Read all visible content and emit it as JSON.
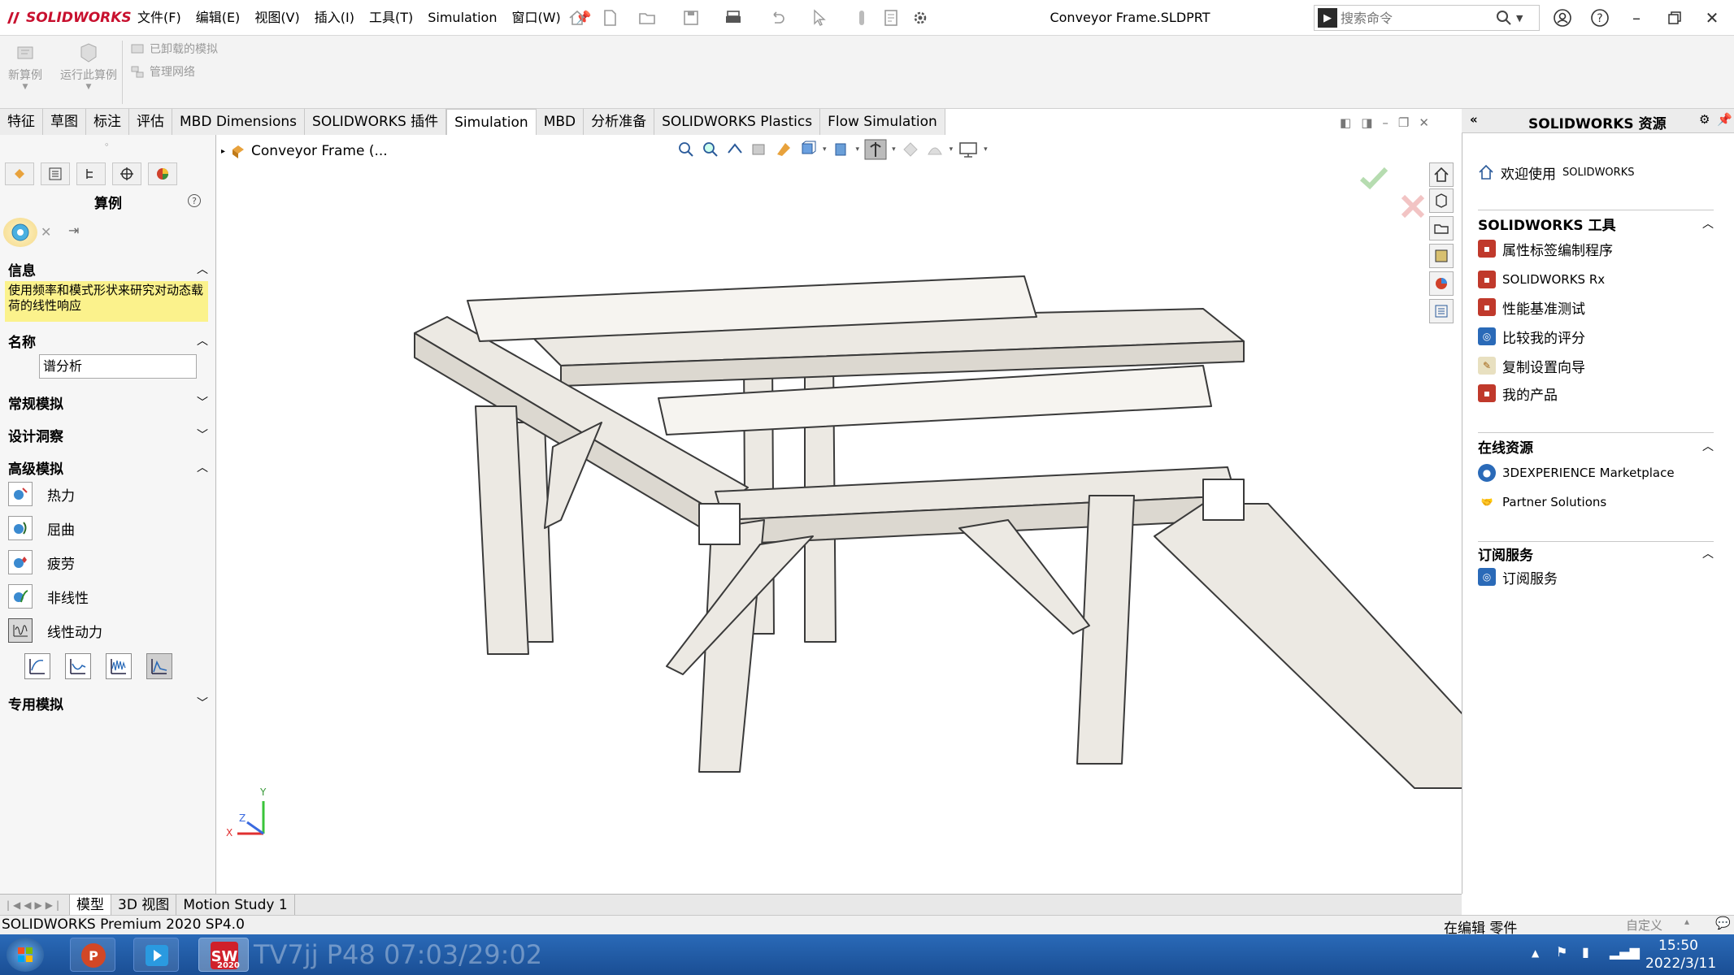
{
  "titlebar": {
    "logo_text": "SOLIDWORKS",
    "menus": [
      "文件(F)",
      "编辑(E)",
      "视图(V)",
      "插入(I)",
      "工具(T)",
      "Simulation",
      "窗口(W)"
    ],
    "doc_title": "Conveyor Frame.SLDPRT",
    "search_placeholder": "搜索命令"
  },
  "command_manager": {
    "buttons": [
      {
        "label": "新算例",
        "icon": "new-study-icon"
      },
      {
        "label": "运行此算例",
        "icon": "run-study-icon"
      }
    ],
    "small_items": [
      {
        "label": "已卸载的模拟",
        "icon": "unloaded-sim-icon"
      },
      {
        "label": "管理网络",
        "icon": "manage-network-icon"
      }
    ],
    "tabs": [
      "特征",
      "草图",
      "标注",
      "评估",
      "MBD Dimensions",
      "SOLIDWORKS 插件",
      "Simulation",
      "MBD",
      "分析准备",
      "SOLIDWORKS Plastics",
      "Flow Simulation"
    ],
    "active_tab": "Simulation"
  },
  "property_manager": {
    "title": "算例",
    "info_heading": "信息",
    "info_text": "使用频率和模式形状来研究对动态载荷的线性响应",
    "name_heading": "名称",
    "name_value": "谱分析",
    "sections": {
      "general": "常规模拟",
      "design_insight": "设计洞察",
      "advanced": "高级模拟",
      "specialized": "专用模拟"
    },
    "advanced_items": [
      {
        "label": "热力",
        "icon": "thermal-icon"
      },
      {
        "label": "屈曲",
        "icon": "buckling-icon"
      },
      {
        "label": "疲劳",
        "icon": "fatigue-icon"
      },
      {
        "label": "非线性",
        "icon": "nonlinear-icon"
      },
      {
        "label": "线性动力",
        "icon": "linear-dynamic-icon"
      }
    ]
  },
  "viewport": {
    "tree_node": "Conveyor Frame  (...",
    "triad": {
      "x": "X",
      "y": "Y",
      "z": "Z"
    }
  },
  "resources": {
    "title": "SOLIDWORKS 资源",
    "welcome": "欢迎使用",
    "welcome_brand": "SOLIDWORKS",
    "tools_heading": "SOLIDWORKS 工具",
    "tools": [
      "属性标签编制程序",
      "SOLIDWORKS Rx",
      "性能基准测试",
      "比较我的评分",
      "复制设置向导",
      "我的产品"
    ],
    "online_heading": "在线资源",
    "online": [
      "3DEXPERIENCE Marketplace",
      "Partner Solutions"
    ],
    "subscription_heading": "订阅服务",
    "subscription": [
      "订阅服务"
    ]
  },
  "bottom_tabs": [
    "模型",
    "3D 视图",
    "Motion Study 1"
  ],
  "status": {
    "left": "SOLIDWORKS Premium 2020 SP4.0",
    "mode": "在编辑 零件",
    "custom": "自定义"
  },
  "taskbar": {
    "overlay": "TV7jj P48 07:03/29:02",
    "time": "15:50",
    "date": "2022/3/11",
    "sw_badge": "2020"
  },
  "colors": {
    "brand": "#c8102e",
    "info_bg": "#fbf28c",
    "taskbar": "#1f5aa6"
  }
}
